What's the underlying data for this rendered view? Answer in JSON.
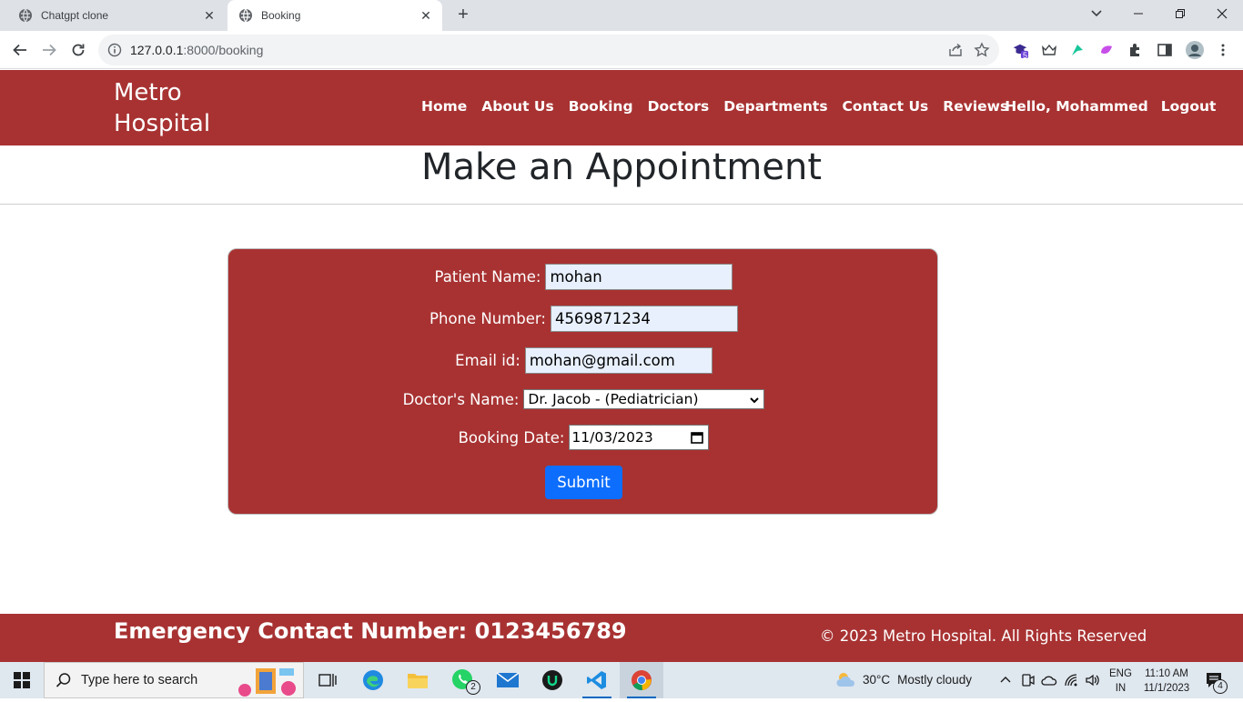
{
  "browser": {
    "tabs": [
      {
        "title": "Chatgpt clone",
        "active": false
      },
      {
        "title": "Booking",
        "active": true
      }
    ],
    "new_tab_symbol": "+",
    "url_host": "127.0.0.1",
    "url_path": ":8000/booking"
  },
  "site": {
    "brand_line1": "Metro",
    "brand_line2": "Hospital",
    "nav": [
      {
        "label": "Home"
      },
      {
        "label": "About Us"
      },
      {
        "label": "Booking"
      },
      {
        "label": "Doctors"
      },
      {
        "label": "Departments"
      },
      {
        "label": "Contact Us"
      },
      {
        "label": "Reviews"
      },
      {
        "label": "Hello, Mohammed"
      },
      {
        "label": "Logout"
      }
    ],
    "header_color": "#a83232"
  },
  "main": {
    "title": "Make an Appointment",
    "form": {
      "patient_name_label": "Patient Name:",
      "patient_name_value": "mohan",
      "phone_label": "Phone Number:",
      "phone_value": "4569871234",
      "email_label": "Email id:",
      "email_value": "mohan@gmail.com",
      "doctor_label": "Doctor's Name:",
      "doctor_value": "Dr. Jacob - (Pediatrician)",
      "date_label": "Booking Date:",
      "date_value": "11/03/2023",
      "submit_label": "Submit",
      "submit_color": "#0d6efd"
    }
  },
  "footer": {
    "emergency": "Emergency Contact Number: 0123456789",
    "copyright": "© 2023 Metro Hospital. All Rights Reserved"
  },
  "taskbar": {
    "search_placeholder": "Type here to search",
    "whatsapp_badge": "2",
    "weather_temp": "30°C",
    "weather_desc": "Mostly cloudy",
    "lang_line1": "ENG",
    "lang_line2": "IN",
    "time": "11:10 AM",
    "date": "11/1/2023",
    "notification_count": "4",
    "extension_badge": "5"
  }
}
